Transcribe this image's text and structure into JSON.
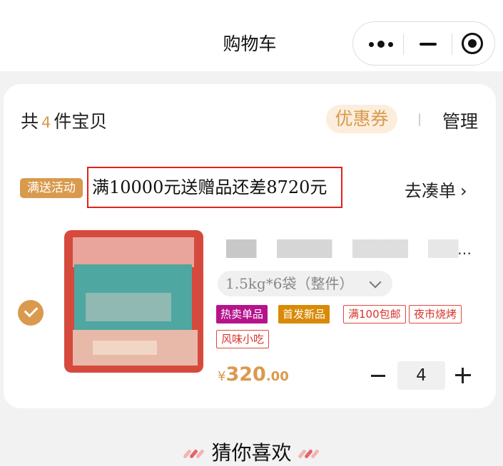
{
  "header": {
    "title": "购物车",
    "capsule": {
      "more_icon": "more-dots-icon",
      "minimize_icon": "minimize-icon",
      "close_icon": "target-icon"
    }
  },
  "cart": {
    "count_prefix": "共",
    "count_value": "4",
    "count_suffix": "件宝贝",
    "coupon_label": "优惠券",
    "manage_label": "管理"
  },
  "promo": {
    "tag": "满送活动",
    "text": "满10000元送赠品还差8720元",
    "go_label": "去凑单",
    "go_icon": "chevron-right-icon"
  },
  "item": {
    "selected": true,
    "title": "…",
    "spec": "1.5kg*6袋（整件）",
    "tags": [
      {
        "label": "热卖单品",
        "style": "filled",
        "color": "#b5148c"
      },
      {
        "label": "首发新品",
        "style": "filled",
        "color": "#d98a06"
      },
      {
        "label": "满100包邮",
        "style": "outline",
        "color": "#e0473f"
      },
      {
        "label": "夜市烧烤",
        "style": "outline",
        "color": "#e0473f"
      },
      {
        "label": "风味小吃",
        "style": "outline",
        "color": "#e0473f"
      }
    ],
    "price_symbol": "¥",
    "price_int": "320",
    "price_dec": ".00",
    "quantity": "4"
  },
  "recommend": {
    "title": "猜你喜欢"
  },
  "colors": {
    "accent": "#d99a4d",
    "highlight_border": "#e0231b"
  }
}
